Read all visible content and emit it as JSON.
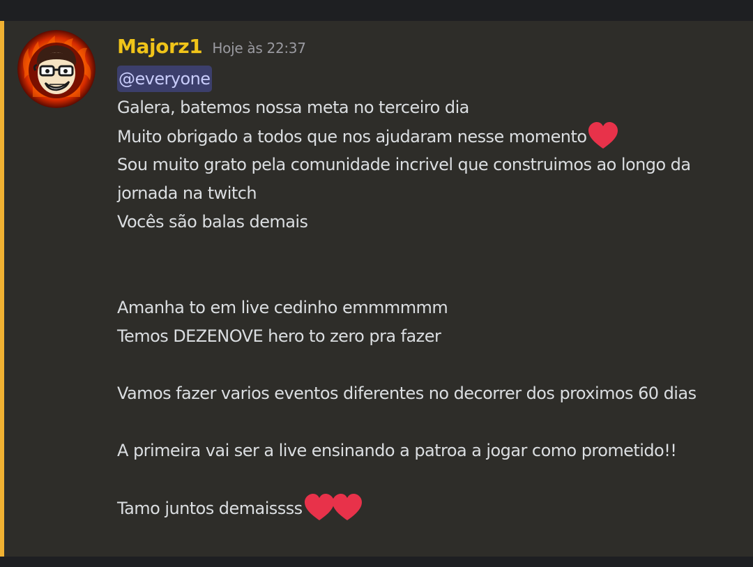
{
  "message": {
    "author": "Majorz1",
    "timestamp": "Hoje às 22:37",
    "mention": "@everyone",
    "lines": [
      "Galera, batemos nossa meta no terceiro dia",
      "Muito obrigado a todos que nos ajudaram nesse momento",
      "Sou muito grato pela comunidade incrivel que construimos ao longo da jornada na twitch",
      "Vocês são balas demais",
      "Amanha to em live cedinho emmmmmm",
      "Temos DEZENOVE hero to zero pra fazer",
      "Vamos fazer varios eventos diferentes no decorrer dos proximos 60 dias",
      "A primeira vai ser a live ensinando a patroa a jogar como prometido!!",
      "Tamo juntos demaissss"
    ],
    "emoji": "heart-emoji"
  },
  "colors": {
    "background": "#2e2d29",
    "username": "#f0c419",
    "mention_stripe": "#f0b132",
    "mention_bg": "#3c3f6c",
    "heart": "#e8324a"
  }
}
